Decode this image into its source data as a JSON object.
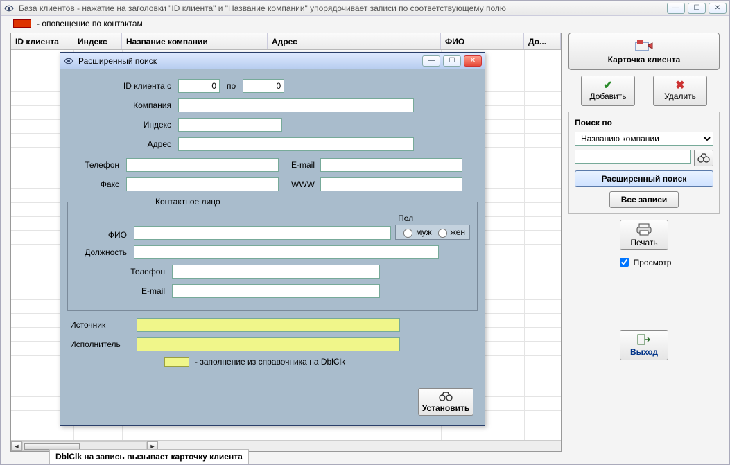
{
  "outer": {
    "title": "База клиентов - нажатие на заголовки \"ID клиента\" и \"Название компании\" упорядочивает записи по соответствующему полю",
    "legend": "- оповещение по контактам"
  },
  "grid": {
    "columns": {
      "id": "ID клиента",
      "idx": "Индекс",
      "company": "Название компании",
      "addr": "Адрес",
      "fio": "ФИО",
      "dol": "До..."
    },
    "footer_hint": "DblClk на запись вызывает карточку клиента"
  },
  "sidebar": {
    "card": "Карточка клиента",
    "add": "Добавить",
    "del": "Удалить",
    "search_by_label": "Поиск по",
    "search_by_value": "Названию компании",
    "adv_search": "Расширенный поиск",
    "all_records": "Все записи",
    "print": "Печать",
    "preview": "Просмотр",
    "exit": "Выход"
  },
  "modal": {
    "title": "Расширенный поиск",
    "id_from_label": "ID клиента с",
    "id_from": "0",
    "id_to_label": "по",
    "id_to": "0",
    "company_label": "Компания",
    "index_label": "Индекс",
    "address_label": "Адрес",
    "phone_label": "Телефон",
    "fax_label": "Факс",
    "email_label": "E-mail",
    "www_label": "WWW",
    "contact_legend": "Контактное лицо",
    "fio_label": "ФИО",
    "pos_label": "Должность",
    "c_phone_label": "Телефон",
    "c_email_label": "E-mail",
    "gender_label": "Пол",
    "gender_m": "муж",
    "gender_f": "жен",
    "source_label": "Источник",
    "executor_label": "Исполнитель",
    "dblclk_hint": "- заполнение из справочника на DblClk",
    "install": "Установить"
  }
}
